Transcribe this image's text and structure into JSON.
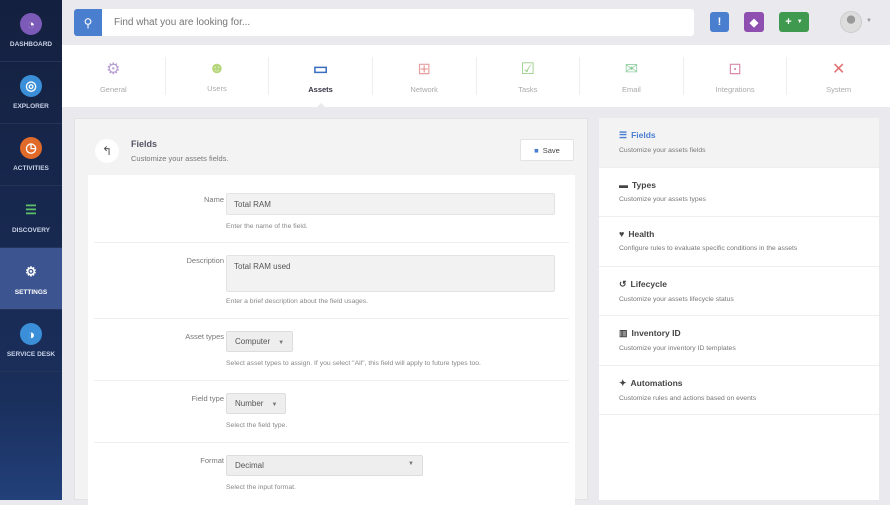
{
  "sidebar": {
    "items": [
      {
        "label": "DASHBOARD",
        "icon": "gauge-icon"
      },
      {
        "label": "EXPLORER",
        "icon": "globe-search-icon"
      },
      {
        "label": "ACTIVITIES",
        "icon": "clock-icon"
      },
      {
        "label": "DISCOVERY",
        "icon": "list-icon"
      },
      {
        "label": "SETTINGS",
        "icon": "gears-icon",
        "active": true
      },
      {
        "label": "SERVICE DESK",
        "icon": "service-desk-icon"
      }
    ]
  },
  "search": {
    "placeholder": "Find what you are looking for..."
  },
  "toolbar": {
    "add_label": "+",
    "colors": {
      "alert": "#4a7fd0",
      "tags": "#8e4fb0",
      "add": "#3f9a4f"
    }
  },
  "tabs": [
    {
      "label": "General"
    },
    {
      "label": "Users"
    },
    {
      "label": "Assets",
      "active": true
    },
    {
      "label": "Network"
    },
    {
      "label": "Tasks"
    },
    {
      "label": "Email"
    },
    {
      "label": "Integrations"
    },
    {
      "label": "System"
    }
  ],
  "panel": {
    "title": "Fields",
    "subtitle": "Customize your assets fields.",
    "save_label": "Save"
  },
  "form": {
    "name": {
      "label": "Name",
      "value": "Total RAM",
      "hint": "Enter the name of the field."
    },
    "description": {
      "label": "Description",
      "value": "Total RAM used",
      "hint": "Enter a brief description about the field usages."
    },
    "asset_types": {
      "label": "Asset types",
      "value": "Computer",
      "hint": "Select asset types to assign. If you select \"All\", this field will apply to future types too."
    },
    "field_type": {
      "label": "Field type",
      "value": "Number",
      "hint": "Select the field type."
    },
    "format": {
      "label": "Format",
      "value": "Decimal",
      "hint": "Select the input format."
    }
  },
  "menu": [
    {
      "title": "Fields",
      "desc": "Customize your assets fields",
      "active": true
    },
    {
      "title": "Types",
      "desc": "Customize your assets types"
    },
    {
      "title": "Health",
      "desc": "Configure rules to evaluate specific conditions in the assets"
    },
    {
      "title": "Lifecycle",
      "desc": "Customize your assets lifecycle status"
    },
    {
      "title": "Inventory ID",
      "desc": "Customize your inventory ID templates"
    },
    {
      "title": "Automations",
      "desc": "Customize rules and actions based on events"
    }
  ]
}
